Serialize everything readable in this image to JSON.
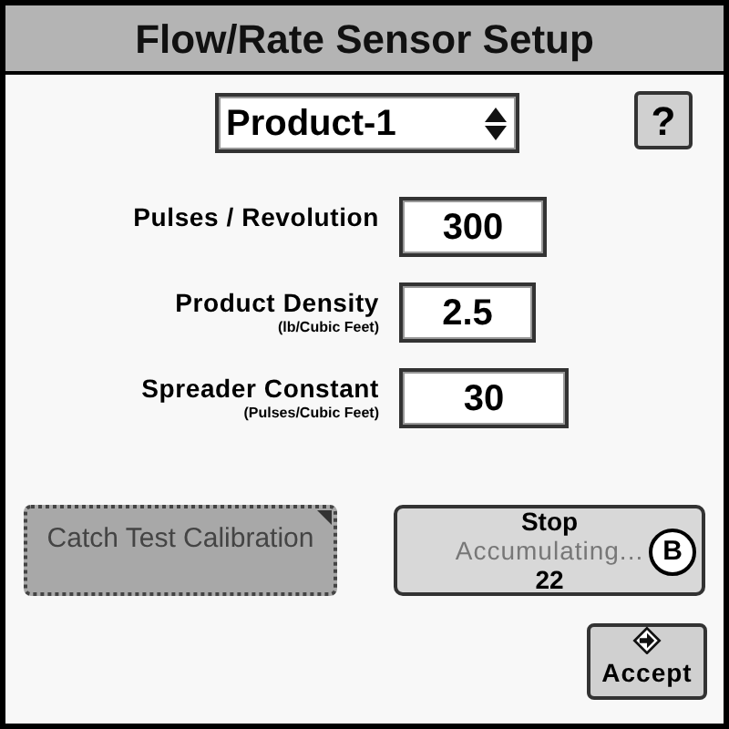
{
  "window": {
    "title": "Flow/Rate Sensor Setup"
  },
  "product_selector": {
    "value": "Product-1"
  },
  "help_button": {
    "label": "?"
  },
  "fields": [
    {
      "label": "Pulses / Revolution",
      "value": "300"
    },
    {
      "label": "Product Density",
      "unit": "(lb/Cubic Feet)",
      "value": "2.5"
    },
    {
      "label": "Spreader Constant",
      "unit": "(Pulses/Cubic Feet)",
      "value": "30"
    }
  ],
  "catch_test_button": {
    "label": "Catch Test Calibration",
    "disabled": true
  },
  "stop_button": {
    "title": "Stop",
    "status": "Accumulating...",
    "count": "22",
    "badge": "B"
  },
  "accept_button": {
    "label": "Accept"
  }
}
